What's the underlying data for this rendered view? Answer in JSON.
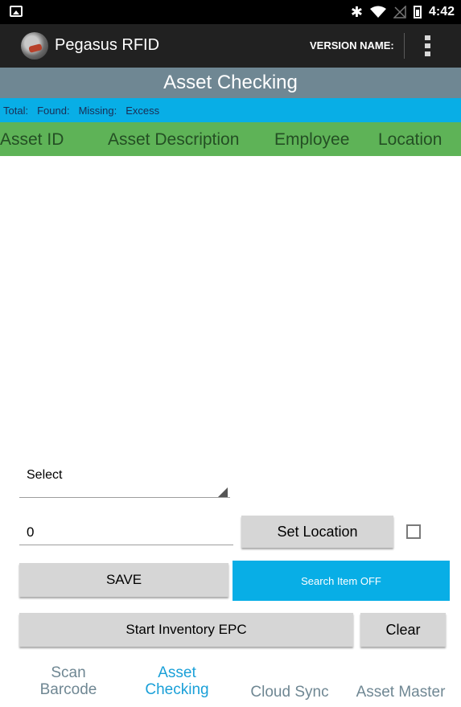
{
  "status_bar": {
    "time": "4:42",
    "icons": [
      "image-icon",
      "bluetooth-icon",
      "wifi-icon",
      "signal-off-icon",
      "battery-icon"
    ]
  },
  "app_bar": {
    "app_name": "Pegasus RFID",
    "version_label": "VERSION NAME:",
    "icons": [
      "logo-icon",
      "overflow-menu-icon"
    ]
  },
  "screen_title": "Asset Checking",
  "summary": {
    "total_label": "Total:",
    "found_label": "Found:",
    "missing_label": "Missing:",
    "excess_label": "Excess"
  },
  "table": {
    "columns": [
      "Asset ID",
      "Asset Description",
      "Employee",
      "Location"
    ],
    "rows": []
  },
  "controls": {
    "select_label": "Select",
    "quantity_value": "0",
    "set_location_label": "Set Location",
    "checkbox_checked": false,
    "save_label": "SAVE",
    "search_item_label": "Search Item OFF",
    "start_inventory_label": "Start Inventory EPC",
    "clear_label": "Clear"
  },
  "bottom_nav": {
    "items": [
      {
        "line1": "Scan",
        "line2": "Barcode",
        "active": false
      },
      {
        "line1": "Asset",
        "line2": "Checking",
        "active": true
      },
      {
        "line1": "Cloud Sync",
        "line2": "",
        "active": false
      },
      {
        "line1": "Asset Master",
        "line2": "",
        "active": false
      }
    ]
  },
  "colors": {
    "status_bar": "#000000",
    "app_bar": "#212121",
    "title_bar": "#6f8793",
    "accent": "#08aee6",
    "table_header": "#5eb357",
    "button_gray": "#d6d6d6",
    "nav_inactive": "#6f8793",
    "nav_active": "#1aa0d8"
  }
}
